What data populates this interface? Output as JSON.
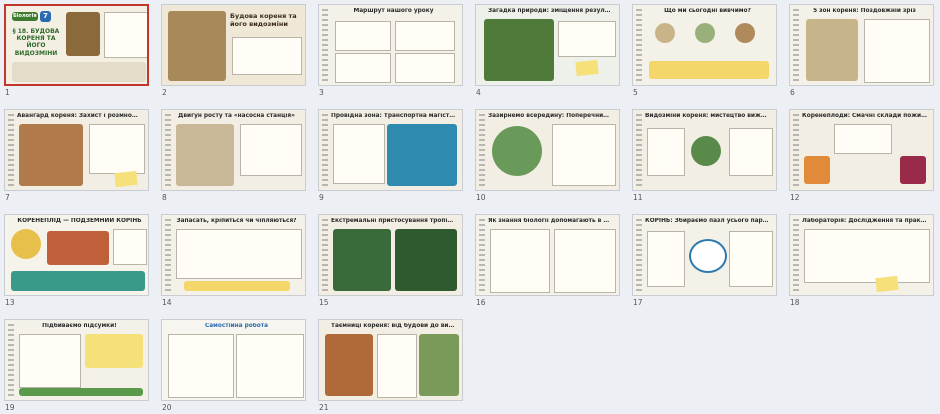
{
  "slides": [
    {
      "number": "1",
      "title": "§ 18. БУДОВА КОРЕНЯ ТА ЙОГО ВИДОЗМІНИ",
      "tag": "Біологія",
      "grade": "7",
      "bg": "#f3efe3",
      "accent": "#3f7a2e"
    },
    {
      "number": "2",
      "title": "Будова кореня та його видозміни",
      "bg": "#efe8d6",
      "accent": "#8a6a3b"
    },
    {
      "number": "3",
      "title": "Маршрут нашого уроку",
      "bg": "#f4f1e8",
      "accent": "#5b7fa8"
    },
    {
      "number": "4",
      "title": "Загадка природи: зміщення результату за минулу зустріч",
      "bg": "#eef0ea",
      "accent": "#4f7a3a"
    },
    {
      "number": "5",
      "title": "Що ми сьогодні вивчимо?",
      "bg": "#f4f1e8",
      "accent": "#a07a3a"
    },
    {
      "number": "6",
      "title": "5 зон кореня: Поздовжній зріз",
      "bg": "#f4f1e8",
      "accent": "#7a8a5a"
    },
    {
      "number": "7",
      "title": "Авангард кореня: Захист і розмноження",
      "bg": "#f2eee4",
      "accent": "#b07a4a"
    },
    {
      "number": "8",
      "title": "Двигун росту та «насосна станція»",
      "bg": "#f2eee4",
      "accent": "#9a8a6a"
    },
    {
      "number": "9",
      "title": "Провідна зона: Транспортна магістраль",
      "bg": "#f2eee4",
      "accent": "#2f8ab0"
    },
    {
      "number": "10",
      "title": "Зазирнемо всередину: Поперечний зріз",
      "bg": "#f2eee4",
      "accent": "#6a9a5a"
    },
    {
      "number": "11",
      "title": "Видозміни кореня: мистецтво виживання",
      "bg": "#f2eee4",
      "accent": "#5a8a4a"
    },
    {
      "number": "12",
      "title": "Коренеплоди: Смачні склади поживних речовин",
      "bg": "#f2eee4",
      "accent": "#c0603a"
    },
    {
      "number": "13",
      "title": "КОРЕНЕПЛІД — ПОДЗЕМНИЙ КОРІНЬ",
      "bg": "#f6f3ea",
      "accent": "#3a9a8a"
    },
    {
      "number": "14",
      "title": "Запасать, кріпиться чи чіпляються?",
      "bg": "#f4f1e8",
      "accent": "#7a6a4a"
    },
    {
      "number": "15",
      "title": "Екстремальні пристосування тропіків",
      "bg": "#f2eee4",
      "accent": "#3a6a3a"
    },
    {
      "number": "16",
      "title": "Як знання біології допомагають в аграрному?",
      "bg": "#f4f1e8",
      "accent": "#5a8a3a"
    },
    {
      "number": "17",
      "title": "КОРІНЬ: Збираємо пазл усього параграфа",
      "bg": "#f4f1e8",
      "accent": "#2a7ab0"
    },
    {
      "number": "18",
      "title": "Лабораторія: Дослідження та практика",
      "bg": "#f4f1e8",
      "accent": "#6a6a6a"
    },
    {
      "number": "19",
      "title": "Підбиваємо підсумки!",
      "bg": "#f4f1e8",
      "accent": "#5a9a4a"
    },
    {
      "number": "20",
      "title": "Самостійна робота",
      "bg": "#f6f5f0",
      "accent": "#3a7ab0"
    },
    {
      "number": "21",
      "title": "Таємниці кореня: від будови до видозмін",
      "bg": "#f2eee4",
      "accent": "#b06a3a"
    }
  ]
}
